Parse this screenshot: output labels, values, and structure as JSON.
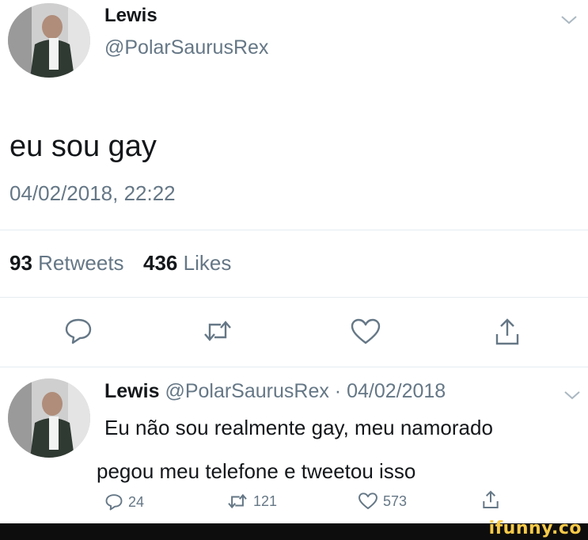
{
  "tweet": {
    "display_name": "Lewis",
    "handle": "@PolarSaurusRex",
    "text": "eu sou gay",
    "timestamp": "04/02/2018, 22:22",
    "retweets_count": "93",
    "retweets_label": "Retweets",
    "likes_count": "436",
    "likes_label": "Likes",
    "icons": [
      "reply-icon",
      "retweet-icon",
      "like-icon",
      "share-icon",
      "chevron-down-icon"
    ]
  },
  "reply": {
    "display_name": "Lewis",
    "meta": "@PolarSaurusRex · 04/02/2018",
    "text_line1": "Eu não sou realmente gay, meu namorado",
    "text_line2": "pegou meu telefone e tweetou isso",
    "reply_count": "24",
    "retweet_count": "121",
    "like_count": "573"
  },
  "watermark": "ifunny.co",
  "colors": {
    "text_primary": "#14171a",
    "text_secondary": "#657786",
    "divider": "#e6ecf0",
    "watermark": "#f7c948"
  }
}
